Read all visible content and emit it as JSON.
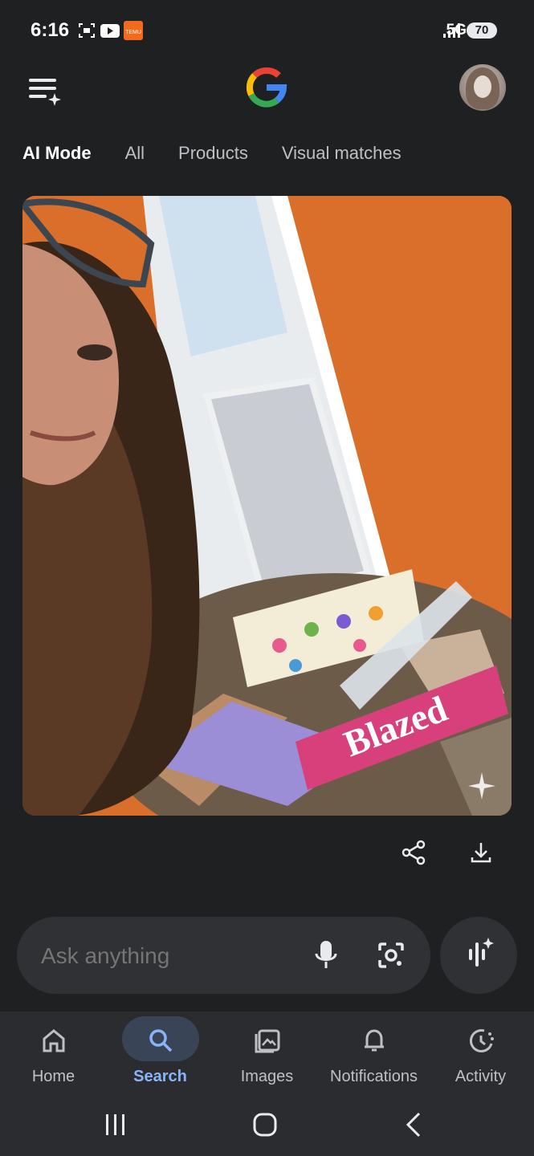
{
  "status_bar": {
    "time": "6:16",
    "network": "5G",
    "battery": "70",
    "icons": [
      "screenshot-icon",
      "youtube-icon",
      "temu-app-icon",
      "signal-icon"
    ]
  },
  "header": {
    "menu_icon": "menu-sparkle-icon",
    "logo_icon": "google-g-logo",
    "avatar_icon": "profile-avatar"
  },
  "tabs": [
    {
      "label": "AI Mode",
      "active": true
    },
    {
      "label": "All",
      "active": false
    },
    {
      "label": "Products",
      "active": false
    },
    {
      "label": "Visual matches",
      "active": false
    }
  ],
  "image": {
    "sticker_text": "Blazed",
    "sparkle_icon": "sparkle-icon"
  },
  "actions": {
    "share_icon": "share-icon",
    "download_icon": "download-icon"
  },
  "search": {
    "placeholder": "Ask anything",
    "mic_icon": "mic-icon",
    "lens_icon": "lens-camera-icon",
    "voice_icon": "voice-mode-icon"
  },
  "bottom_nav": [
    {
      "label": "Home",
      "icon": "home-icon",
      "active": false
    },
    {
      "label": "Search",
      "icon": "search-icon",
      "active": true
    },
    {
      "label": "Images",
      "icon": "images-icon",
      "active": false
    },
    {
      "label": "Notifications",
      "icon": "bell-icon",
      "active": false
    },
    {
      "label": "Activity",
      "icon": "activity-icon",
      "active": false
    }
  ],
  "colors": {
    "background": "#1f2022",
    "pill": "#303134",
    "accent": "#8ab4f8",
    "orange_wall": "#d96f2a"
  }
}
